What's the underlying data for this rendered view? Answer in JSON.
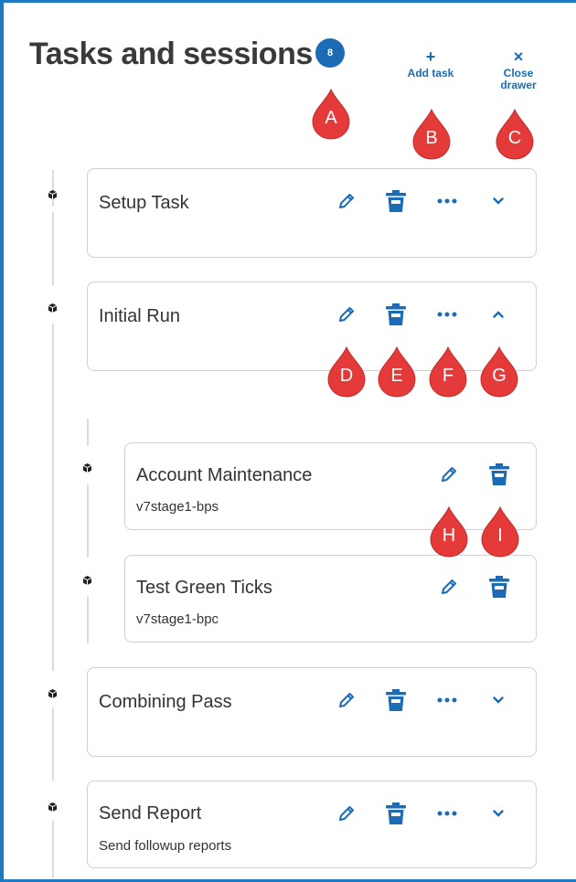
{
  "header": {
    "title": "Tasks and sessions",
    "count": "8",
    "add_task_label": "Add task",
    "close_drawer_label": "Close drawer"
  },
  "tasks": [
    {
      "title": "Setup Task",
      "subtitle": "",
      "expanded": false
    },
    {
      "title": "Initial Run",
      "subtitle": "",
      "expanded": true,
      "sessions": [
        {
          "title": "Account Maintenance",
          "subtitle": "v7stage1-bps"
        },
        {
          "title": "Test Green Ticks",
          "subtitle": "v7stage1-bpc"
        }
      ]
    },
    {
      "title": "Combining Pass",
      "subtitle": "",
      "expanded": false
    },
    {
      "title": "Send Report",
      "subtitle": "Send followup reports",
      "expanded": false
    }
  ],
  "callouts": [
    "A",
    "B",
    "C",
    "D",
    "E",
    "F",
    "G",
    "H",
    "I"
  ],
  "colors": {
    "accent": "#1b6cb4",
    "callout": "#e53a3a",
    "border": "#1f7ac4"
  },
  "icons": [
    "pencil-icon",
    "trash-icon",
    "more-icon",
    "chevron-down-icon",
    "chevron-up-icon",
    "plus-icon",
    "close-icon",
    "cube-icon"
  ]
}
